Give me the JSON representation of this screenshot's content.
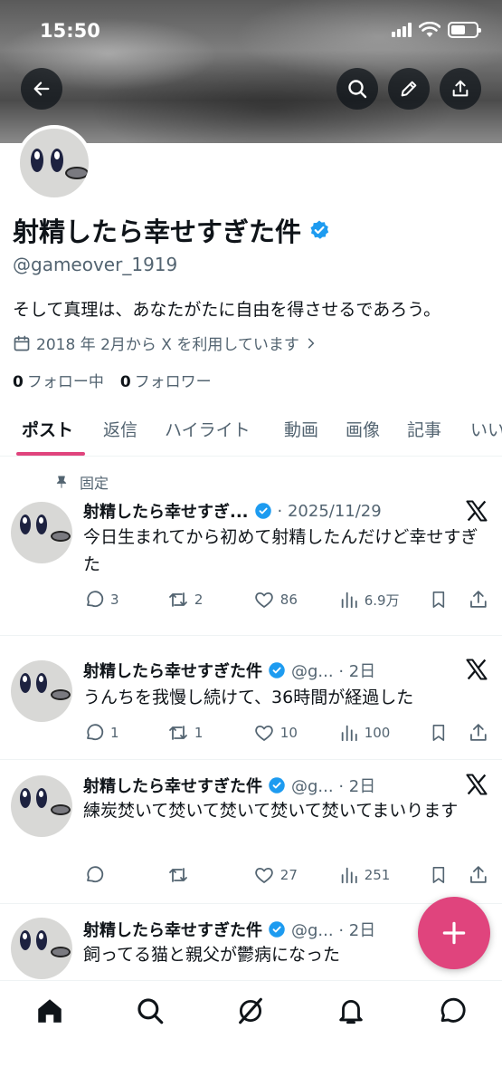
{
  "status": {
    "time": "15:50"
  },
  "profile": {
    "name": "射精したら幸せすぎた件",
    "handle": "@gameover_1919",
    "bio": "そして真理は、あなたがたに自由を得させるであろう。",
    "joined": "2018 年 2月から X を利用しています",
    "following_count": "0",
    "following_label": "フォロー中",
    "followers_count": "0",
    "followers_label": "フォロワー"
  },
  "tabs": [
    "ポスト",
    "返信",
    "ハイライト",
    "動画",
    "画像",
    "記事",
    "いい"
  ],
  "pinned_label": "固定",
  "posts": [
    {
      "name": "射精したら幸せすぎ...",
      "meta": "· 2025/11/29",
      "text": "今日生まれてから初めて射精したんだけど幸せすぎた",
      "replies": "3",
      "reposts": "2",
      "likes": "86",
      "views": "6.9万"
    },
    {
      "name": "射精したら幸せすぎた件",
      "meta": "@g... · 2日",
      "text": "うんちを我慢し続けて、36時間が経過した",
      "replies": "1",
      "reposts": "1",
      "likes": "10",
      "views": "100"
    },
    {
      "name": "射精したら幸せすぎた件",
      "meta": "@g... · 2日",
      "text": "練炭焚いて焚いて焚いて焚いて焚いてまいります",
      "replies": "",
      "reposts": "",
      "likes": "27",
      "views": "251"
    },
    {
      "name": "射精したら幸せすぎた件",
      "meta": "@g... · 2日",
      "text": "飼ってる猫と親父が鬱病になった"
    }
  ],
  "colors": {
    "accent": "#e0447d",
    "verified": "#1d9bf0",
    "muted": "#536471"
  }
}
